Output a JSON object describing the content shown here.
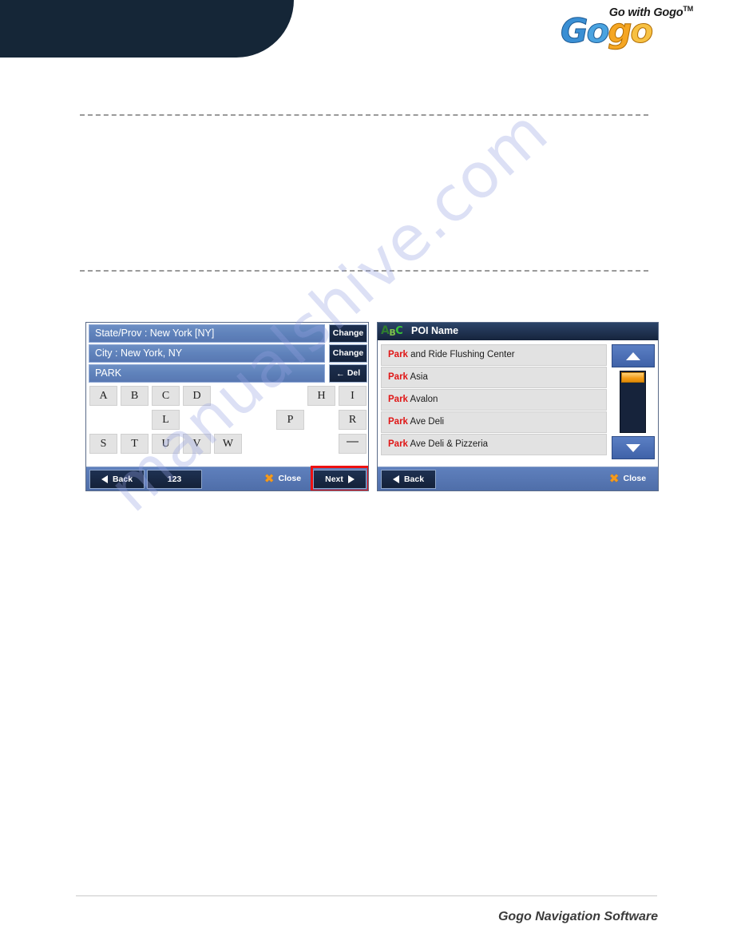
{
  "brand": {
    "tagline": "Go with Gogo",
    "tm": "TM",
    "logo_g1": "G",
    "logo_o1": "o",
    "logo_g2": "g",
    "logo_o2": "o",
    "accent_blue": "#3a8fd4",
    "accent_orange": "#f5a623"
  },
  "footer": {
    "text": "Gogo Navigation Software"
  },
  "watermark": {
    "text": "manualshive.com"
  },
  "left_screen": {
    "fields": [
      {
        "label": "State/Prov : New York [NY]",
        "button": "Change",
        "button_icon": ""
      },
      {
        "label": "City : New York, NY",
        "button": "Change",
        "button_icon": ""
      },
      {
        "label": "PARK",
        "button": "Del",
        "button_icon": "←"
      }
    ],
    "keyboard": {
      "rows": [
        [
          {
            "key": "A",
            "col": 0
          },
          {
            "key": "B",
            "col": 1
          },
          {
            "key": "C",
            "col": 2
          },
          {
            "key": "D",
            "col": 3
          },
          {
            "key": "H",
            "col": 7
          },
          {
            "key": "I",
            "col": 8
          }
        ],
        [
          {
            "key": "L",
            "col": 2
          },
          {
            "key": "P",
            "col": 6
          },
          {
            "key": "R",
            "col": 8
          }
        ],
        [
          {
            "key": "S",
            "col": 0
          },
          {
            "key": "T",
            "col": 1
          },
          {
            "key": "U",
            "col": 2
          },
          {
            "key": "V",
            "col": 3
          },
          {
            "key": "W",
            "col": 4
          },
          {
            "key": "—",
            "col": 8,
            "name": "space"
          }
        ]
      ]
    },
    "toolbar": {
      "back": "Back",
      "numeric": "123",
      "close": "Close",
      "next": "Next",
      "highlight_color": "#ee1111"
    }
  },
  "right_screen": {
    "title": "POI Name",
    "title_icon": {
      "a": "A",
      "b": "B",
      "c": "C"
    },
    "results": [
      {
        "match": "Park",
        "rest": " and Ride Flushing Center"
      },
      {
        "match": "Park",
        "rest": " Asia"
      },
      {
        "match": "Park",
        "rest": " Avalon"
      },
      {
        "match": "Park",
        "rest": " Ave Deli"
      },
      {
        "match": "Park",
        "rest": " Ave Deli & Pizzeria"
      }
    ],
    "scroll": {
      "up": "▲",
      "down": "▼"
    },
    "toolbar": {
      "back": "Back",
      "close": "Close"
    }
  }
}
